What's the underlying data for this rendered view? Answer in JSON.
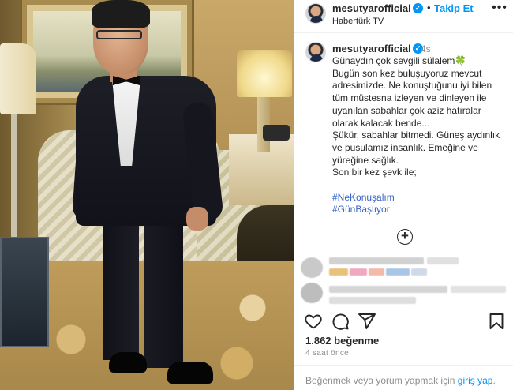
{
  "post": {
    "username": "mesutyarofficial",
    "verified_symbol": "✓",
    "follow_label": "Takip Et",
    "dot_separator": "•",
    "subtitle": "Habertürk TV",
    "more_symbol": "•••",
    "photo_description_icon": "portrait-photo"
  },
  "caption": {
    "username": "mesutyarofficial",
    "age": "4s",
    "lines": [
      "Günaydın çok sevgili sülalem🍀",
      "Bugün son kez buluşuyoruz mevcut",
      "adresimizde. Ne konuştuğunu iyi bilen",
      "tüm müstesna izleyen ve dinleyen ile",
      "uyanılan sabahlar çok aziz hatıralar",
      "olarak kalacak bende...",
      "Şükür, sabahlar bitmedi. Güneş aydınlık",
      "ve pusulamız insanlık. Emeğine ve",
      "yüreğine sağlık.",
      "Son bir kez şevk ile;"
    ],
    "hashtags": [
      "#NeKonuşalım",
      "#GünBaşlıyor"
    ]
  },
  "add_symbol": "+",
  "actions": {
    "like_icon": "heart-icon",
    "comment_icon": "comment-icon",
    "share_icon": "share-icon",
    "save_icon": "bookmark-icon"
  },
  "likes_label": "1.862 beğenme",
  "time_label": "4 saat önce",
  "footer": {
    "prefix": "Beğenmek veya yorum yapmak için",
    "link": "giriş yap",
    "suffix": "."
  },
  "colors": {
    "accent": "#0095f6",
    "text": "#262626",
    "muted": "#8e8e8e"
  }
}
